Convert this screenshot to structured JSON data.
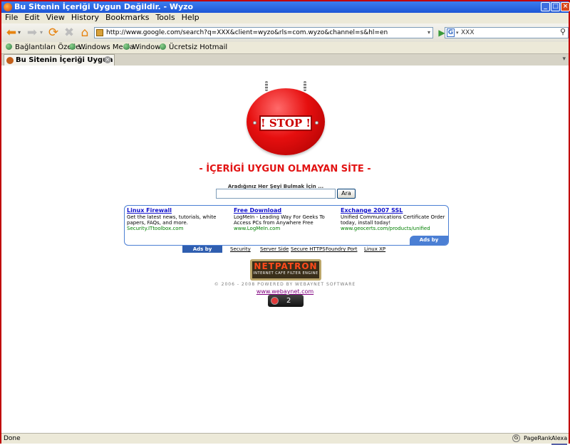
{
  "window": {
    "title": "Bu Sitenin İçeriği Uygun Değildir. - Wyzo",
    "controls": [
      "_",
      "□",
      "×"
    ]
  },
  "menu": [
    "File",
    "Edit",
    "View",
    "History",
    "Bookmarks",
    "Tools",
    "Help"
  ],
  "navbar": {
    "url": "http://www.google.com/search?q=XXX&client=wyzo&rls=com.wyzo&channel=s&hl=en",
    "search_value": "XXX",
    "search_engine_letter": "G"
  },
  "bookmarks": [
    "Bağlantıları Özelle...",
    "Windows Media",
    "Windows",
    "Ücretsiz Hotmail"
  ],
  "tab": {
    "label": "Bu Sitenin İçeriği Uygun Değildir."
  },
  "page": {
    "sign_text": "! STOP !",
    "headline": "- İÇERİGİ UYGUN OLMAYAN SİTE -",
    "search_label": "Aradığınız Her Şeyi Bulmak İçin ...",
    "search_button": "Ara",
    "ads": [
      {
        "title": "Linux Firewall",
        "desc": "Get the latest news, tutorials, white papers, FAQs, and more.",
        "url": "Security.ITtoolbox.com"
      },
      {
        "title": "Free Download",
        "desc": "LogMeIn - Leading Way For Geeks To Access PCs from Anywhere Free",
        "url": "www.LogMeIn.com"
      },
      {
        "title": "Exchange 2007 SSL",
        "desc": "Unified Communications Certificate Order today, install today!",
        "url": "www.geocerts.com/products/unified"
      }
    ],
    "ads_by_google_corner": "Ads by Google",
    "ads_by_google_label": "Ads by Google",
    "links": [
      "Security",
      "Server Side",
      "Secure HTTPS",
      "Foundry Port",
      "Linux XP"
    ],
    "logo_name": "NETPATRON",
    "logo_sub": "INTERNET CAFE FILTER ENGINE",
    "copyright": "© 2006 - 2008 POWERED BY WEBAYNET SOFTWARE",
    "site_link": "www.webaynet.com",
    "counter": "2"
  },
  "status": {
    "text": "Done",
    "pagerank": "PageRank",
    "alexa": "Alexa"
  },
  "colors": {
    "titlebar": "#1e57d6",
    "headline": "#e21313",
    "ad_title": "#1111cc",
    "ad_url": "#008000",
    "stop_sign": "#e60f0f"
  }
}
